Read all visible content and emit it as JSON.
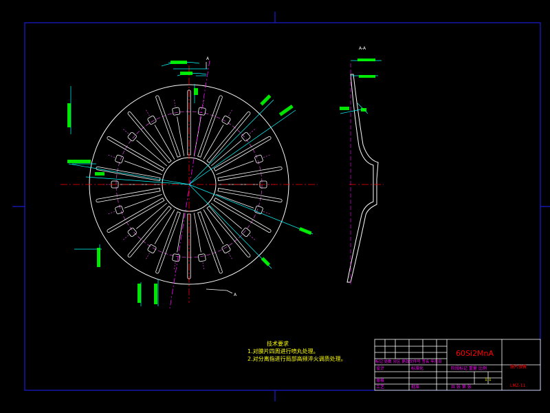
{
  "colors": {
    "background": "#000000",
    "frame": "#2020ff",
    "outline": "#ffffff",
    "center_line": "#ff0000",
    "dimension": "#00ffff",
    "dim_text": "#00ff00",
    "note_text": "#ffff00",
    "title_text": "#ff00ff",
    "hidden": "#c040c0"
  },
  "view": {
    "section_label": "A-A",
    "cut_mark": "A"
  },
  "notes": {
    "heading": "技术要求",
    "line1": "1.对膜片四周进行喷丸处理。",
    "line2": "2.对分离指进行局部高频淬火调质处理。"
  },
  "title_block": {
    "material": "60Si2MnA",
    "part_name": "膜片弹簧",
    "drawing_no": "LMZ-11",
    "scale": "1:1",
    "designer": "设计",
    "standard": "标准化",
    "review": "审核",
    "process": "工艺",
    "approve": "批准",
    "revision_row": "标记 处数 分区 更改文件号 签名 年月日",
    "stage_row": "阶段标记 重量 比例",
    "sheet_row": "共 张 第 张"
  }
}
